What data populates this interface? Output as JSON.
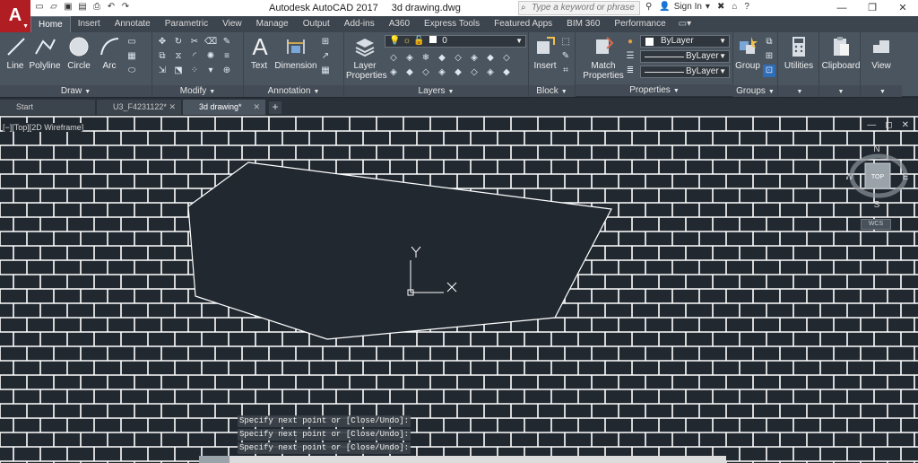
{
  "app": {
    "logo": "A",
    "title": "Autodesk AutoCAD 2017",
    "filename": "3d drawing.dwg"
  },
  "qat_icons": [
    "new-icon",
    "open-icon",
    "save-icon",
    "save-as-icon",
    "print-icon",
    "undo-icon",
    "redo-icon"
  ],
  "search": {
    "placeholder": "Type a keyword or phrase"
  },
  "account": {
    "signin": "Sign In"
  },
  "ribbon_tabs": [
    "Home",
    "Insert",
    "Annotate",
    "Parametric",
    "View",
    "Manage",
    "Output",
    "Add-ins",
    "A360",
    "Express Tools",
    "Featured Apps",
    "BIM 360",
    "Performance"
  ],
  "ribbon": {
    "draw": {
      "footer": "Draw",
      "buttons": [
        "Line",
        "Polyline",
        "Circle",
        "Arc"
      ]
    },
    "modify": {
      "footer": "Modify"
    },
    "annotation": {
      "footer": "Annotation",
      "buttons": [
        "Text",
        "Dimension"
      ]
    },
    "layers": {
      "footer": "Layers",
      "button": "Layer Properties",
      "current_layer": "0"
    },
    "block": {
      "footer": "Block",
      "button": "Insert"
    },
    "properties": {
      "footer": "Properties",
      "button": "Match Properties",
      "color": "ByLayer",
      "linetype": "ByLayer",
      "lineweight": "ByLayer"
    },
    "groups": {
      "footer": "Groups",
      "button": "Group"
    },
    "utilities": {
      "button": "Utilities"
    },
    "clipboard": {
      "button": "Clipboard"
    },
    "view": {
      "button": "View"
    }
  },
  "file_tabs": [
    {
      "label": "Start"
    },
    {
      "label": "U3_F4231122*"
    },
    {
      "label": "3d drawing*"
    }
  ],
  "viewport": {
    "label": "[−][Top][2D Wireframe]"
  },
  "viewcube": {
    "north": "N",
    "south": "S",
    "east": "E",
    "west": "W",
    "face": "TOP",
    "wcs": "WCS"
  },
  "ucs": {
    "x": "X",
    "y": "Y"
  },
  "command_history": [
    "Specify next point or [Close/Undo]:",
    "Specify next point or [Close/Undo]:",
    "Specify next point or [Close/Undo]:"
  ],
  "colors": {
    "canvas": "#212830",
    "brick_lines": "#ffffff",
    "ribbon": "#4b5560",
    "app_red": "#b01d22"
  }
}
